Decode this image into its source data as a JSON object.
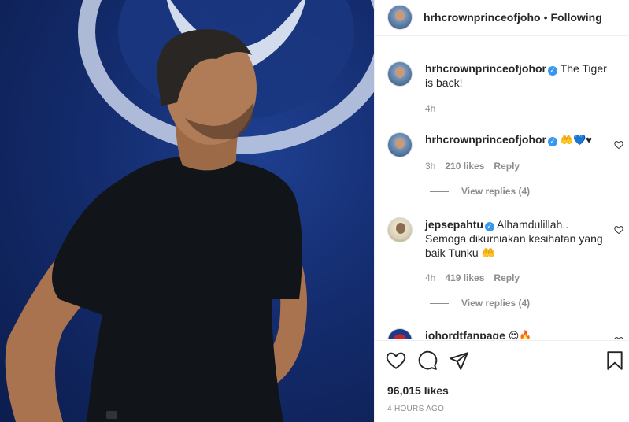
{
  "header": {
    "username": "hrhcrownprinceofjoho",
    "separator": "•",
    "follow_status": "Following",
    "more": "•••"
  },
  "comments": [
    {
      "username": "hrhcrownprinceofjohor",
      "text": "The Tiger is back!",
      "time": "4h"
    },
    {
      "username": "hrhcrownprinceofjohor",
      "text": "🤲💙♥",
      "time": "3h",
      "likes": "210 likes",
      "reply": "Reply",
      "view_replies": "View replies (4)"
    },
    {
      "username": "jepsepahtu",
      "text": "Alhamdulillah.. Semoga dikurniakan kesihatan yang baik Tunku 🤲",
      "time": "4h",
      "likes": "419 likes",
      "reply": "Reply",
      "view_replies": "View replies (4)"
    },
    {
      "username": "johordtfanpage",
      "text": "😍🔥"
    }
  ],
  "footer": {
    "likes": "96,015 likes",
    "timestamp": "4 HOURS AGO"
  },
  "icons": {
    "like": "heart-icon",
    "comment": "comment-icon",
    "share": "share-icon",
    "save": "bookmark-icon",
    "verified": "verified-badge-icon"
  },
  "colors": {
    "verified": "#3897f0",
    "muted": "#8e8e8e",
    "text": "#262626"
  }
}
